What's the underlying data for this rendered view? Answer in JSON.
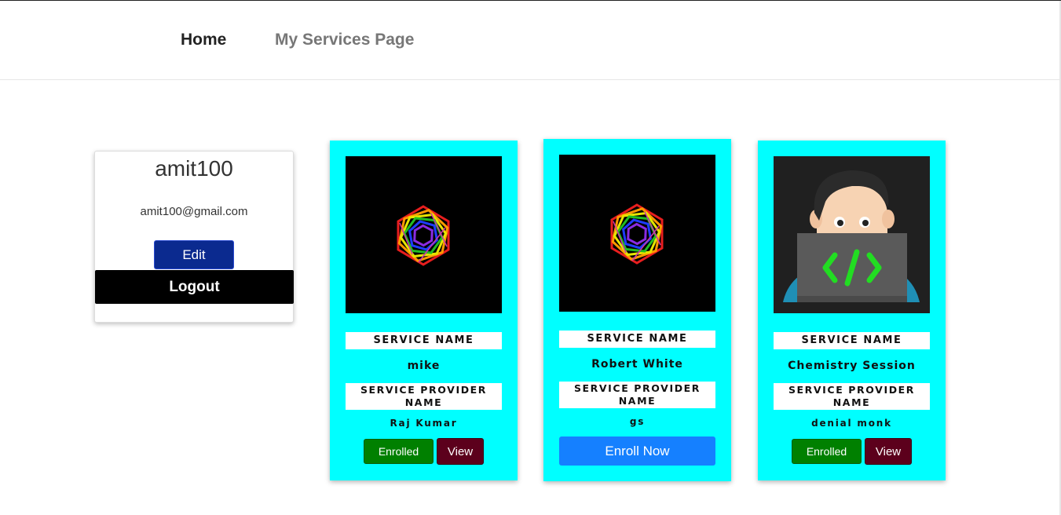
{
  "nav": {
    "home": "Home",
    "services": "My Services Page"
  },
  "profile": {
    "username": "amit100",
    "email": "amit100@gmail.com",
    "edit_label": "Edit",
    "logout_label": "Logout"
  },
  "cards": [
    {
      "image_icon": "rainbow-hexagon-spiral",
      "service_name_label": "SERVICE NAME",
      "service_name": "mike",
      "provider_label": "SERVICE PROVIDER NAME",
      "provider_name": "Raj Kumar",
      "status_label": "Enrolled",
      "view_label": "View"
    },
    {
      "image_icon": "rainbow-hexagon-spiral",
      "service_name_label": "SERVICE NAME",
      "service_name": "Robert White",
      "provider_label": "SERVICE PROVIDER NAME",
      "provider_name": "gs",
      "enroll_label": "Enroll Now"
    },
    {
      "image_icon": "developer-laptop-code",
      "service_name_label": "SERVICE NAME",
      "service_name": "Chemistry Session",
      "provider_label": "SERVICE PROVIDER NAME",
      "provider_name": "denial monk",
      "status_label": "Enrolled",
      "view_label": "View"
    }
  ],
  "colors": {
    "card_bg": "#00ffff",
    "enrolled_bg": "#008000",
    "view_bg": "#5c001c",
    "enroll_bg": "#1580ff",
    "edit_bg": "#0b2a8f",
    "logout_bg": "#000000"
  }
}
